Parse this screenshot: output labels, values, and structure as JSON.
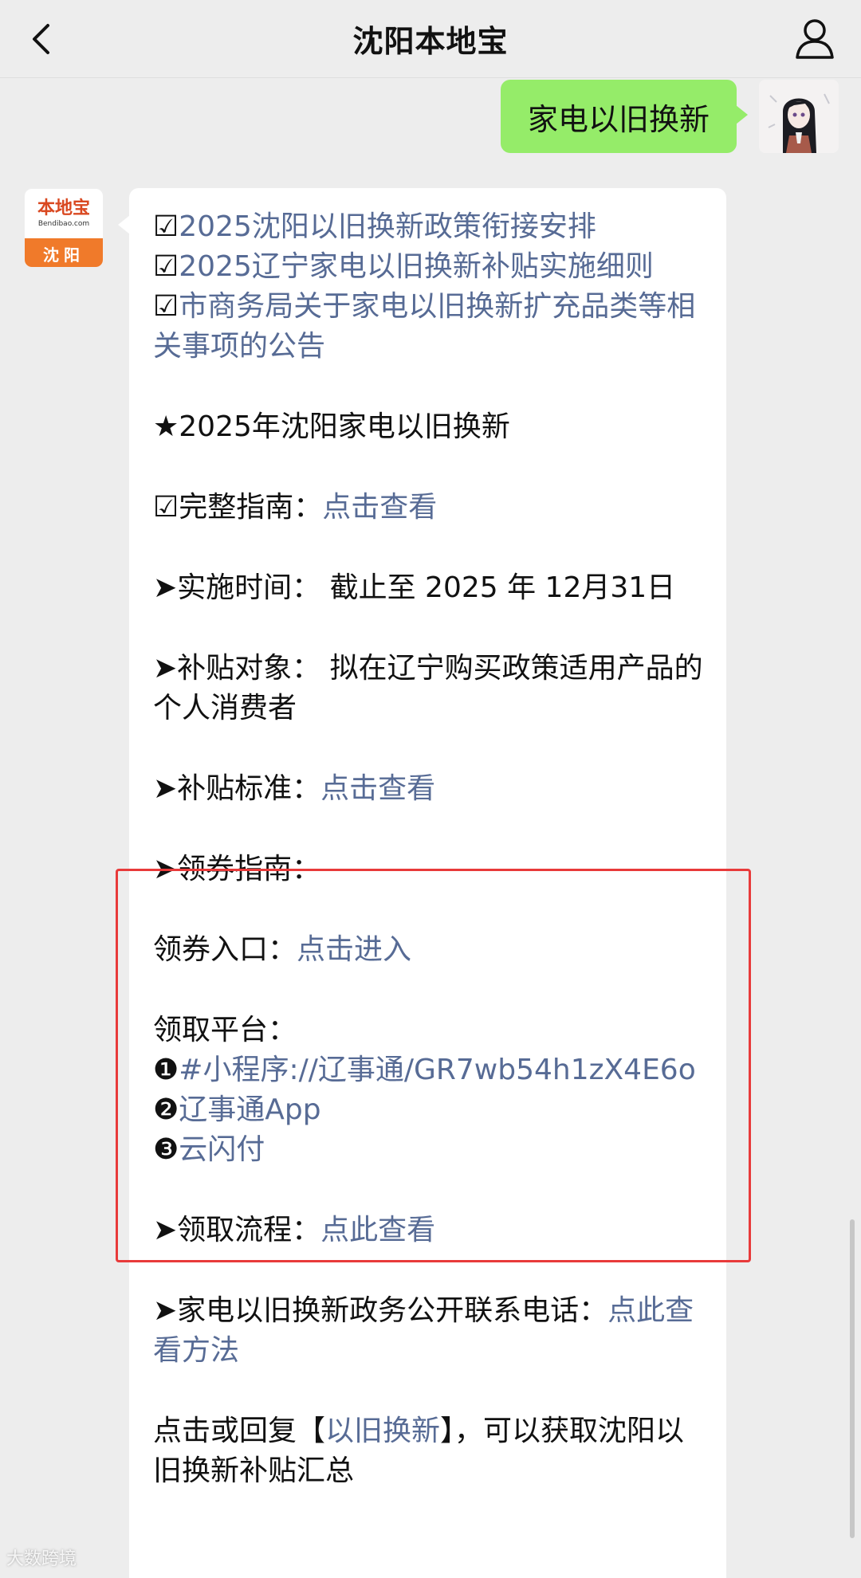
{
  "header": {
    "title": "沈阳本地宝"
  },
  "sent": {
    "text": "家电以旧换新"
  },
  "bot": {
    "logo_text": "本地宝",
    "logo_sub": "Bendibao.com",
    "city": "沈阳"
  },
  "message": {
    "p1": {
      "glyph": "☑",
      "text": "2025沈阳以旧换新政策衔接安排"
    },
    "p2": {
      "glyph": "☑",
      "text": "2025辽宁家电以旧换新补贴实施细则"
    },
    "p3": {
      "glyph": "☑",
      "text": "市商务局关于家电以旧换新扩充品类等相关事项的公告"
    },
    "heading": "★2025年沈阳家电以旧换新",
    "guide": {
      "glyph": "☑",
      "label": "完整指南：",
      "link": "点击查看"
    },
    "period": "➤实施时间：  截止至 2025 年 12月31日",
    "target": "➤补贴对象：  拟在辽宁购买政策适用产品的个人消费者",
    "standard": {
      "label": "➤补贴标准：",
      "link": "点击查看"
    },
    "coupon_guide": "➤领券指南：",
    "entry": {
      "label": "领券入口：",
      "link": "点击进入"
    },
    "platform_label": "领取平台：",
    "platforms": [
      {
        "num": "❶",
        "text": "#小程序://辽事通/GR7wb54h1zX4E6o"
      },
      {
        "num": "❷",
        "text": "辽事通App"
      },
      {
        "num": "❸",
        "text": "云闪付"
      }
    ],
    "process": {
      "label": "➤领取流程：",
      "link": "点此查看"
    },
    "contact": {
      "label": "➤家电以旧换新政务公开联系电话：",
      "link": "点此查看方法"
    },
    "reply": {
      "prefix": "点击或回复【",
      "link": "以旧换新",
      "suffix": "】，可以获取沈阳以旧换新补贴汇总"
    }
  },
  "watermark": "大数跨境"
}
